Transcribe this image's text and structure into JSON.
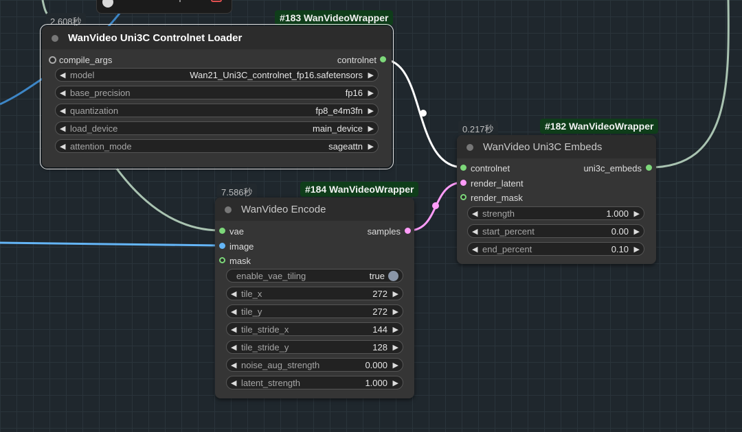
{
  "colors": {
    "canvas_bg": "#1f272d",
    "node_bg": "#353535",
    "badge_bg": "#0f3d1a",
    "slot_controlnet": "#7dd87a",
    "slot_vae": "#7dd87a",
    "slot_image": "#64b5f6",
    "slot_latent": "#ff9cf9",
    "wire_controlnet": "#ffffff",
    "wire_latent": "#ff9cf9",
    "wire_generic": "#a9c3b1",
    "wire_image": "#64b5f6"
  },
  "nodes": {
    "loader": {
      "timing": "2.608秒",
      "badge": "#183 WanVideoWrapper",
      "title": "WanVideo Uni3C Controlnet Loader",
      "inputs": [
        "compile_args"
      ],
      "outputs": [
        "controlnet"
      ],
      "widgets": [
        {
          "label": "model",
          "value": "Wan21_Uni3C_controlnet_fp16.safetensors"
        },
        {
          "label": "base_precision",
          "value": "fp16"
        },
        {
          "label": "quantization",
          "value": "fp8_e4m3fn"
        },
        {
          "label": "load_device",
          "value": "main_device"
        },
        {
          "label": "attention_mode",
          "value": "sageattn"
        }
      ]
    },
    "encode": {
      "timing": "7.586秒",
      "badge": "#184 WanVideoWrapper",
      "title": "WanVideo Encode",
      "inputs": [
        "vae",
        "image",
        "mask"
      ],
      "outputs": [
        "samples"
      ],
      "toggle": {
        "label": "enable_vae_tiling",
        "value": "true"
      },
      "widgets": [
        {
          "label": "tile_x",
          "value": "272"
        },
        {
          "label": "tile_y",
          "value": "272"
        },
        {
          "label": "tile_stride_x",
          "value": "144"
        },
        {
          "label": "tile_stride_y",
          "value": "128"
        },
        {
          "label": "noise_aug_strength",
          "value": "0.000"
        },
        {
          "label": "latent_strength",
          "value": "1.000"
        }
      ]
    },
    "embeds": {
      "timing": "0.217秒",
      "badge": "#182 WanVideoWrapper",
      "title": "WanVideo Uni3C Embeds",
      "inputs": [
        "controlnet",
        "render_latent",
        "render_mask"
      ],
      "outputs": [
        "uni3c_embeds"
      ],
      "widgets": [
        {
          "label": "strength",
          "value": "1.000"
        },
        {
          "label": "start_percent",
          "value": "0.00"
        },
        {
          "label": "end_percent",
          "value": "0.10"
        }
      ]
    }
  }
}
